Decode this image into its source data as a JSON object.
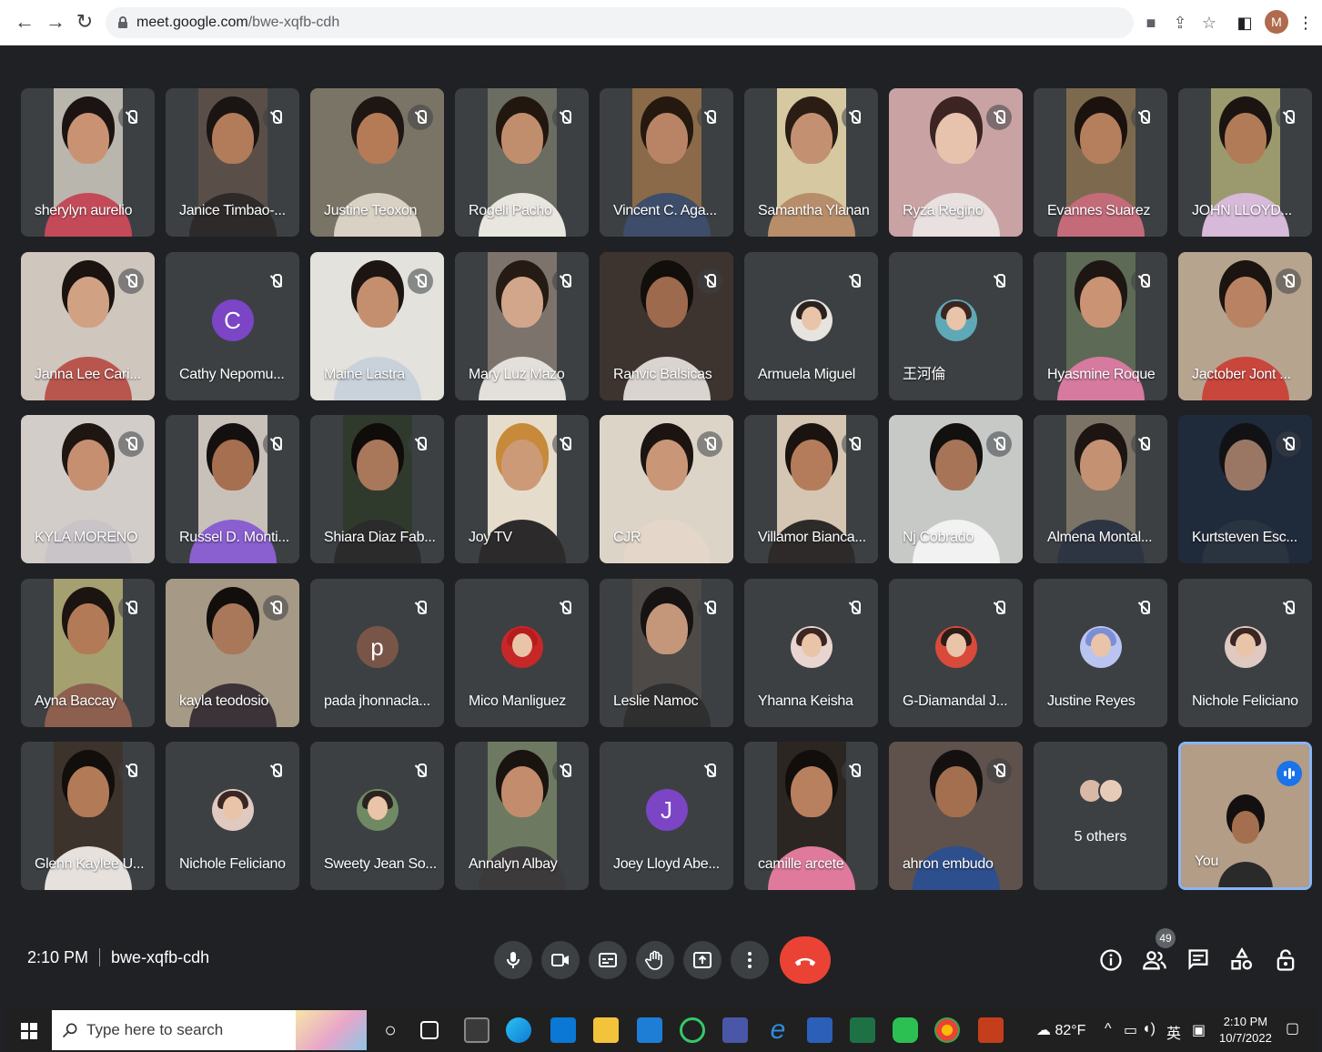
{
  "browser": {
    "url_host": "meet.google.com",
    "url_path": "/bwe-xqfb-cdh",
    "profile_initial": "M"
  },
  "participants": [
    {
      "name": "sherylyn aurelio",
      "type": "video",
      "bg": "#b9b6ae",
      "skin": "#c99272",
      "hair": "#1b1412",
      "shirt": "#c44a59"
    },
    {
      "name": "Janice Timbao-...",
      "type": "video",
      "bg": "#5a4f48",
      "skin": "#b27b5a",
      "hair": "#1a1413",
      "shirt": "#2e2a2a"
    },
    {
      "name": "Justine Teoxon",
      "type": "video",
      "bg": "#7a7466",
      "skin": "#b57a56",
      "hair": "#1d1612",
      "shirt": "#d9d2c4",
      "full": true
    },
    {
      "name": "Rogeli Pacho",
      "type": "video",
      "bg": "#6b6c62",
      "skin": "#c18e6d",
      "hair": "#22170f",
      "shirt": "#e9e6e0"
    },
    {
      "name": "Vincent C. Aga...",
      "type": "video",
      "bg": "#8a6a48",
      "skin": "#b98466",
      "hair": "#24180f",
      "shirt": "#3e4d6a"
    },
    {
      "name": "Samantha Ylanan",
      "type": "video",
      "bg": "#d6c9a2",
      "skin": "#c39172",
      "hair": "#2b1d14",
      "shirt": "#b88e6a"
    },
    {
      "name": "Ryza Regino",
      "type": "video",
      "bg": "#c9a3a4",
      "skin": "#e7c2ad",
      "hair": "#3b2421",
      "shirt": "#e9e0e0",
      "full": true
    },
    {
      "name": "Evannes Suarez",
      "type": "video",
      "bg": "#7d6a4e",
      "skin": "#b57e5c",
      "hair": "#1b120d",
      "shirt": "#c46b7a"
    },
    {
      "name": "JOHN LLOYD...",
      "type": "video",
      "bg": "#9b9a6e",
      "skin": "#b27b58",
      "hair": "#1b1411",
      "shirt": "#d7b9d9"
    },
    {
      "name": "Janna Lee Cari...",
      "type": "video",
      "bg": "#cfc6be",
      "skin": "#d0a283",
      "hair": "#1a1310",
      "shirt": "#b8564e",
      "full": true
    },
    {
      "name": "Cathy Nepomu...",
      "type": "letter",
      "letter": "C",
      "color": "#7b45c6"
    },
    {
      "name": "Maine Lastra",
      "type": "video",
      "bg": "#e3e2dc",
      "skin": "#c48f6e",
      "hair": "#1d1512",
      "shirt": "#c9d2db",
      "full": true
    },
    {
      "name": "Mary Luz Mazo",
      "type": "video",
      "bg": "#7c736c",
      "skin": "#d2a68a",
      "hair": "#261a14",
      "shirt": "#e3dfda"
    },
    {
      "name": "Ranvic Balsicas",
      "type": "video",
      "bg": "#3d3430",
      "skin": "#9d6a4e",
      "hair": "#120e0c",
      "shirt": "#d9d4cf",
      "full": true
    },
    {
      "name": "Armuela Miguel",
      "type": "avatar",
      "hair": "#2b2220",
      "bg": "#e7e3df"
    },
    {
      "name": "王河倫",
      "type": "avatar",
      "hair": "#3b2620",
      "bg": "#5fa8b8"
    },
    {
      "name": "Hyasmine Roque",
      "type": "video",
      "bg": "#5d6a56",
      "skin": "#c99374",
      "hair": "#1e1613",
      "shirt": "#d67aa0"
    },
    {
      "name": "Jactober Jont ...",
      "type": "video",
      "bg": "#b7a48f",
      "skin": "#b98262",
      "hair": "#1b1410",
      "shirt": "#c9463d",
      "full": true
    },
    {
      "name": "KYLA MORENO",
      "type": "video",
      "bg": "#d2cdc9",
      "skin": "#c58f70",
      "hair": "#1f1612",
      "shirt": "#c9c4c8",
      "full": true
    },
    {
      "name": "Russel D. Monti...",
      "type": "video",
      "bg": "#c8c1ba",
      "skin": "#a66f4f",
      "hair": "#141010",
      "shirt": "#8a5fd0"
    },
    {
      "name": "Shiara Diaz Fab...",
      "type": "video",
      "bg": "#2f3a2c",
      "skin": "#a9775a",
      "hair": "#100c0a",
      "shirt": "#2b2b2b"
    },
    {
      "name": "Joy TV",
      "type": "video",
      "bg": "#e6dccb",
      "skin": "#cd9a77",
      "hair": "#c68a3a",
      "shirt": "#2c2a2a"
    },
    {
      "name": "CJR",
      "type": "video",
      "bg": "#ddd4c8",
      "skin": "#c99677",
      "hair": "#1c1411",
      "shirt": "#e4d7c9",
      "full": true
    },
    {
      "name": "Villamor Bianca...",
      "type": "video",
      "bg": "#d4c6b2",
      "skin": "#b57c5c",
      "hair": "#1a1310",
      "shirt": "#2e2a2a"
    },
    {
      "name": "Nj Cobrado",
      "type": "video",
      "bg": "#c7c9c7",
      "skin": "#a87457",
      "hair": "#131010",
      "shirt": "#f2f2f2",
      "full": true
    },
    {
      "name": "Almena Montal...",
      "type": "video",
      "bg": "#7b7466",
      "skin": "#c49272",
      "hair": "#1c1512",
      "shirt": "#2e3542"
    },
    {
      "name": "Kurtsteven Esc...",
      "type": "video",
      "bg": "#1f2a3a",
      "skin": "#9a7764",
      "hair": "#121214",
      "shirt": "#2a3340",
      "full": true
    },
    {
      "name": "Ayna Baccay",
      "type": "video",
      "bg": "#a5a06f",
      "skin": "#b37a58",
      "hair": "#1b1410",
      "shirt": "#8c5f4e"
    },
    {
      "name": "kayla teodosio",
      "type": "video",
      "bg": "#a69a87",
      "skin": "#a9775a",
      "hair": "#120e0c",
      "shirt": "#3b3338",
      "full": true
    },
    {
      "name": "pada jhonnacla...",
      "type": "letter",
      "letter": "p",
      "color": "#795548"
    },
    {
      "name": "Mico Manliguez",
      "type": "avatar",
      "hair": "#b71c1c",
      "bg": "#c62828"
    },
    {
      "name": "Leslie Namoc",
      "type": "video",
      "bg": "#4d4a48",
      "skin": "#c4967a",
      "hair": "#171313",
      "shirt": "#2f2f2f"
    },
    {
      "name": "Yhanna Keisha",
      "type": "avatar",
      "hair": "#3a2622",
      "bg": "#e8d5cf"
    },
    {
      "name": "G-Diamandal J...",
      "type": "avatar",
      "hair": "#2b1d18",
      "bg": "#d94a3a"
    },
    {
      "name": "Justine Reyes",
      "type": "avatar",
      "hair": "#7a8fd6",
      "bg": "#b9c4f0"
    },
    {
      "name": "Nichole Feliciano",
      "type": "avatar",
      "hair": "#3a2622",
      "bg": "#dfc9c0"
    },
    {
      "name": "Glenn Kaylee U...",
      "type": "video",
      "bg": "#3d332d",
      "skin": "#b27a57",
      "hair": "#120e0c",
      "shirt": "#e6e1dd"
    },
    {
      "name": "Nichole Feliciano",
      "type": "avatar",
      "hair": "#3a2622",
      "bg": "#dfc9c0"
    },
    {
      "name": "Sweety Jean So...",
      "type": "avatar",
      "hair": "#2b2220",
      "bg": "#6f8a63"
    },
    {
      "name": "Annalyn Albay",
      "type": "video",
      "bg": "#6d7a61",
      "skin": "#c28c6d",
      "hair": "#1a1411",
      "shirt": "#3c3a3a"
    },
    {
      "name": "Joey Lloyd Abe...",
      "type": "letter",
      "letter": "J",
      "color": "#7b45c6"
    },
    {
      "name": "camille arcete",
      "type": "video",
      "bg": "#2c2623",
      "skin": "#b8805f",
      "hair": "#120e0c",
      "shirt": "#e07a9c"
    },
    {
      "name": "ahron embudo",
      "type": "video",
      "bg": "#5f514c",
      "skin": "#a46f4f",
      "hair": "#141010",
      "shirt": "#2d4f8e",
      "full": true
    },
    {
      "name": "",
      "type": "others",
      "label": "5 others"
    },
    {
      "name": "You",
      "type": "self",
      "bg": "#b39d86",
      "skin": "#a46f4f",
      "hair": "#141010",
      "shirt": "#2a2a2a"
    }
  ],
  "meeting": {
    "time": "2:10 PM",
    "code": "bwe-xqfb-cdh",
    "people_count": "49"
  },
  "taskbar": {
    "search_placeholder": "Type here to search",
    "weather": "82°F",
    "ime": "英",
    "time": "2:10 PM",
    "date": "10/7/2022"
  },
  "colors": {
    "meet_bg": "#202124",
    "tile_bg": "#3c4043",
    "end_call": "#ea4335",
    "active_speaker": "#8ab4f8"
  }
}
